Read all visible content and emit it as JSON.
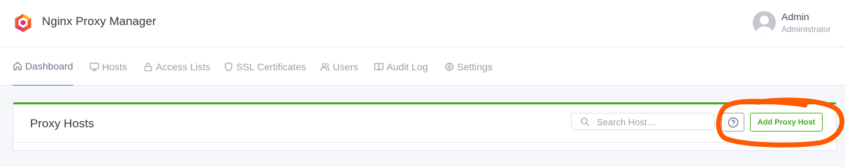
{
  "app": {
    "title": "Nginx Proxy Manager",
    "logo_icon": "hexagon-logo-icon",
    "brand_colors": [
      "#f15833",
      "#e0356e",
      "#fdb913"
    ]
  },
  "user": {
    "name": "Admin",
    "role": "Administrator",
    "avatar_icon": "user-avatar-icon"
  },
  "nav": {
    "items": [
      {
        "label": "Dashboard",
        "icon": "home-icon",
        "active": true
      },
      {
        "label": "Hosts",
        "icon": "monitor-icon",
        "active": false
      },
      {
        "label": "Access Lists",
        "icon": "lock-icon",
        "active": false
      },
      {
        "label": "SSL Certificates",
        "icon": "shield-icon",
        "active": false
      },
      {
        "label": "Users",
        "icon": "users-icon",
        "active": false
      },
      {
        "label": "Audit Log",
        "icon": "book-icon",
        "active": false
      },
      {
        "label": "Settings",
        "icon": "gear-icon",
        "active": false
      }
    ]
  },
  "card": {
    "title": "Proxy Hosts",
    "accent_color": "#45aa22"
  },
  "search": {
    "placeholder": "Search Host…",
    "value": "",
    "icon": "search-icon"
  },
  "help": {
    "icon": "help-circle-icon"
  },
  "add_button": {
    "label": "Add Proxy Host",
    "color": "#45aa22"
  },
  "annotation": {
    "shape": "hand-drawn-circle",
    "color": "#ff5a00"
  }
}
